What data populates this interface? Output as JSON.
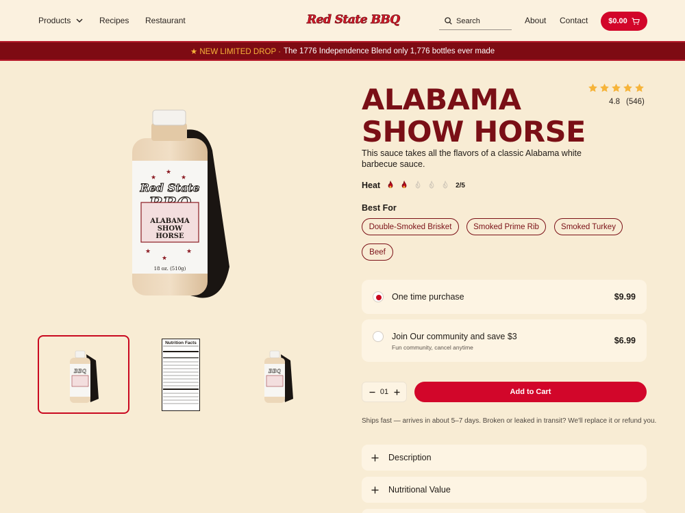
{
  "nav": {
    "products": "Products",
    "recipes": "Recipes",
    "restaurant": "Restaurant",
    "logo": "Red State BBQ",
    "search_placeholder": "Search",
    "about": "About",
    "contact": "Contact",
    "cart_total": "$0.00"
  },
  "banner": {
    "highlight": "★ NEW LIMITED DROP ·",
    "text": "The 1776 Independence Blend only 1,776 bottles ever made"
  },
  "product": {
    "title_line1": "ALABAMA",
    "title_line2": "SHOW HORSE",
    "rating": "4.8",
    "review_count": "(546)",
    "stars": 5,
    "description": "This sauce takes all the flavors of a classic Alabama white barbecue sauce.",
    "heat_label": "Heat",
    "heat_level": 2,
    "heat_max": 5,
    "heat_score": "2/5",
    "best_for_label": "Best For",
    "best_for": [
      "Double-Smoked Brisket",
      "Smoked Prime Rib",
      "Smoked Turkey",
      "Beef"
    ],
    "bottle_label": {
      "brand_line1": "Red State",
      "brand_line2": "BBQ",
      "name_line1": "ALABAMA",
      "name_line2": "SHOW",
      "name_line3": "HORSE",
      "size": "18 oz. (510g)"
    },
    "nutrition_title": "Nutrition Facts"
  },
  "purchase": {
    "one_time_label": "One time purchase",
    "one_time_price": "$9.99",
    "subscribe_label": "Join Our community and save $3",
    "subscribe_sub": "Fun community, cancel anytime",
    "subscribe_price": "$6.99",
    "selected": "one_time",
    "quantity": "01",
    "add_to_cart": "Add to Cart",
    "shipping_note": "Ships fast — arrives in about 5–7 days. Broken or leaked in transit? We'll replace it or refund you."
  },
  "accordion": {
    "description": "Description",
    "nutrition": "Nutritional Value"
  },
  "colors": {
    "accent": "#d2062a",
    "title": "#7a0f16",
    "background": "#f8ecd4",
    "banner": "#7e0b13",
    "star": "#f6b43a"
  }
}
